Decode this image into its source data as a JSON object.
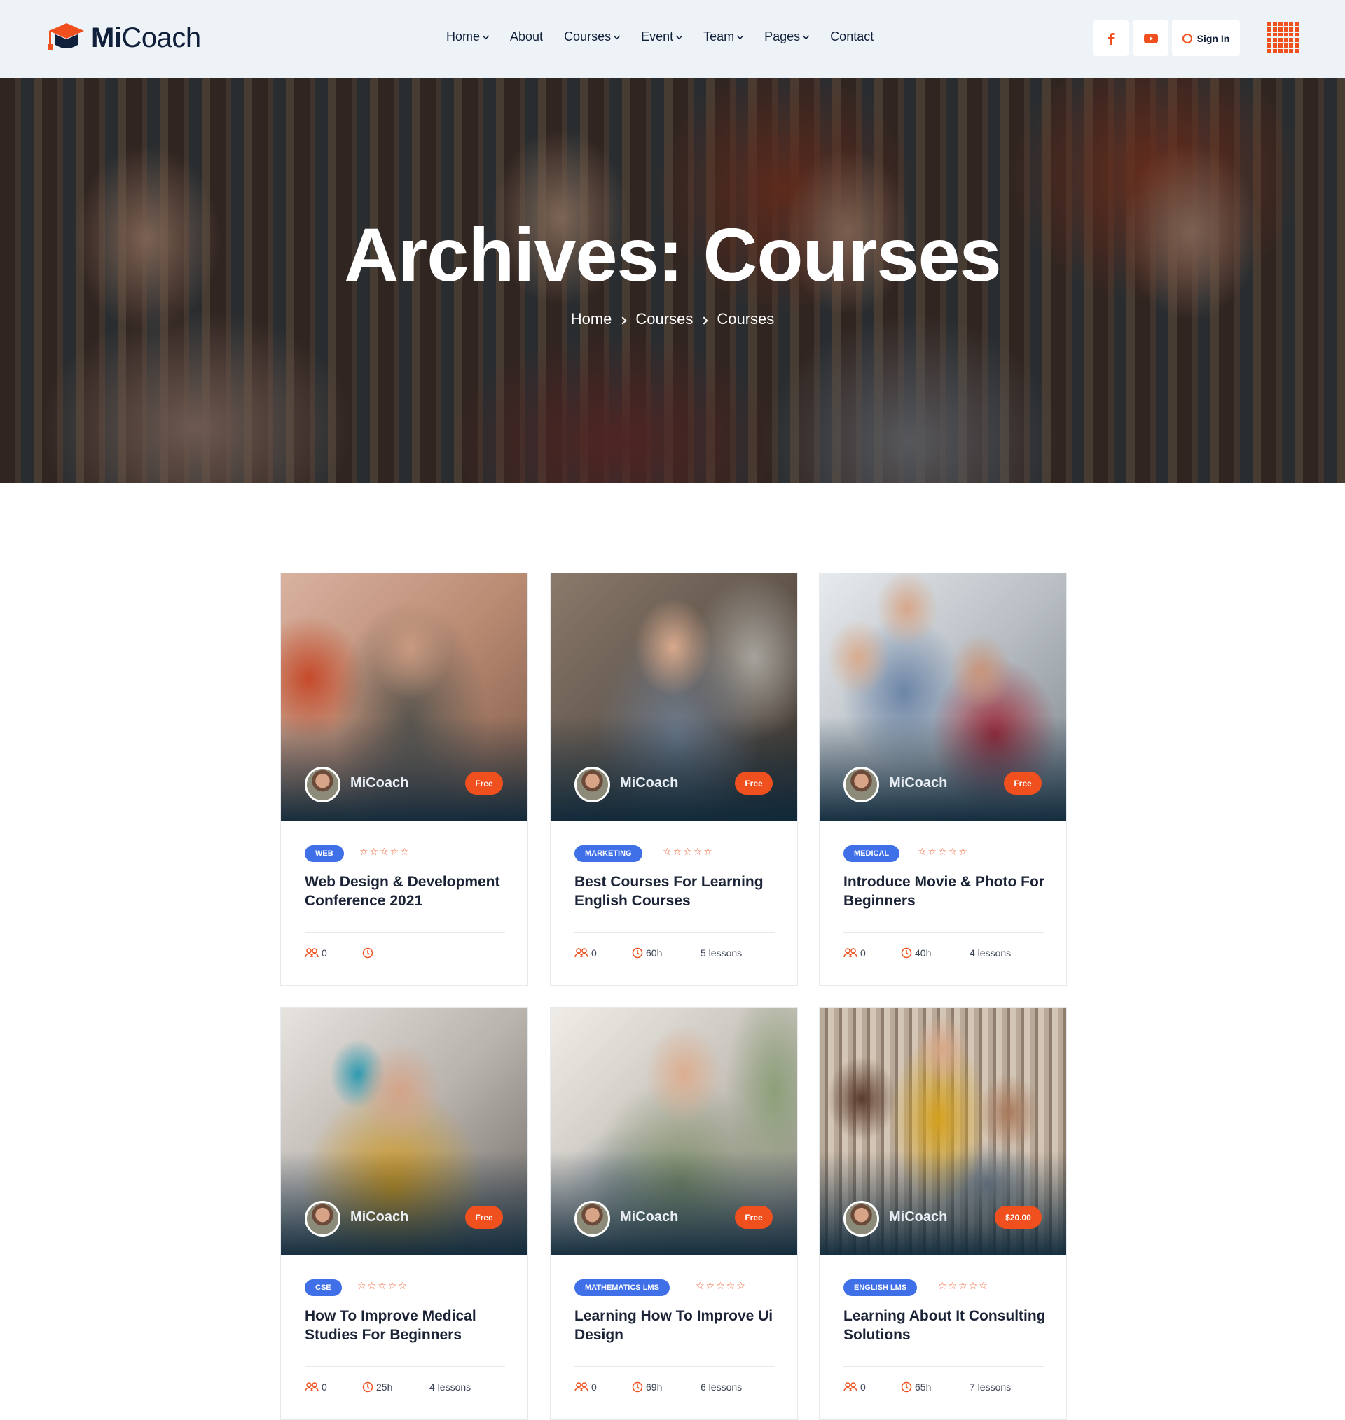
{
  "brand": {
    "name_bold": "Mi",
    "name_light": "Coach",
    "accent": "#f0501e",
    "navy": "#10203a",
    "badge_blue": "#3f70e8"
  },
  "nav": [
    {
      "label": "Home",
      "dropdown": true
    },
    {
      "label": "About",
      "dropdown": false
    },
    {
      "label": "Courses",
      "dropdown": true
    },
    {
      "label": "Event",
      "dropdown": true
    },
    {
      "label": "Team",
      "dropdown": true
    },
    {
      "label": "Pages",
      "dropdown": true
    },
    {
      "label": "Contact",
      "dropdown": false
    }
  ],
  "header_actions": {
    "facebook_icon": "facebook-icon",
    "youtube_icon": "youtube-icon",
    "signin_label": "Sign In",
    "menu_icon": "grid-menu-icon"
  },
  "hero": {
    "title": "Archives: Courses",
    "breadcrumb": [
      "Home",
      "Courses",
      "Courses"
    ]
  },
  "courses": [
    {
      "author": "MiCoach",
      "price": "Free",
      "category": "WEB",
      "rating_stars": "☆☆☆☆☆",
      "title": "Web Design & Development Conference 2021",
      "students": "0",
      "duration": "",
      "lessons": ""
    },
    {
      "author": "MiCoach",
      "price": "Free",
      "category": "MARKETING",
      "rating_stars": "☆☆☆☆☆",
      "title": "Best Courses For Learning English Courses",
      "students": "0",
      "duration": "60h",
      "lessons": "5 lessons"
    },
    {
      "author": "MiCoach",
      "price": "Free",
      "category": "MEDICAL",
      "rating_stars": "☆☆☆☆☆",
      "title": "Introduce Movie & Photo For Beginners",
      "students": "0",
      "duration": "40h",
      "lessons": "4 lessons"
    },
    {
      "author": "MiCoach",
      "price": "Free",
      "category": "CSE",
      "rating_stars": "☆☆☆☆☆",
      "title": "How To Improve Medical Studies For Beginners",
      "students": "0",
      "duration": "25h",
      "lessons": "4 lessons"
    },
    {
      "author": "MiCoach",
      "price": "Free",
      "category": "MATHEMATICS LMS",
      "rating_stars": "☆☆☆☆☆",
      "title": "Learning How To Improve Ui Design",
      "students": "0",
      "duration": "69h",
      "lessons": "6 lessons"
    },
    {
      "author": "MiCoach",
      "price": "$20.00",
      "category": "ENGLISH LMS",
      "rating_stars": "☆☆☆☆☆",
      "title": "Learning About It Consulting Solutions",
      "students": "0",
      "duration": "65h",
      "lessons": "7 lessons"
    }
  ]
}
